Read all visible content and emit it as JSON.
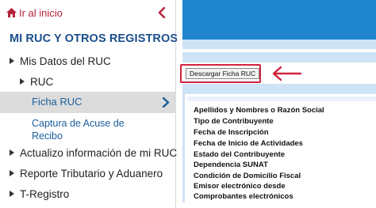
{
  "sidebar": {
    "home_label": "Ir al inicio",
    "title": "MI RUC Y OTROS REGISTROS",
    "items": [
      {
        "label": "Mis Datos del RUC"
      },
      {
        "label": "RUC"
      },
      {
        "label": "Ficha RUC"
      },
      {
        "label": "Captura de Acuse de Recibo"
      },
      {
        "label": "Actualizo información de mi RUC"
      },
      {
        "label": "Reporte Tributario y Aduanero"
      },
      {
        "label": "T-Registro"
      }
    ]
  },
  "main": {
    "download_button_label": "Descargar Ficha RUC",
    "fields": [
      "Apellidos y Nombres o Razón Social",
      "Tipo de Contribuyente",
      "Fecha de Inscripción",
      "Fecha de Inicio de Actividades",
      "Estado del Contribuyente",
      "Dependencia SUNAT",
      "Condición de Domicilio Fiscal",
      "Emisor electrónico desde",
      "Comprobantes electrónicos"
    ]
  },
  "colors": {
    "brand_red": "#b5233a",
    "title_blue": "#1a4f8c",
    "link_blue": "#1a5f9c",
    "header_blue": "#1f85cf",
    "light_blue": "#cfe3f6",
    "active_gray": "#dcdcdc",
    "annotation_red": "#d0233e"
  },
  "icons": {
    "home": "home-icon",
    "collapse": "chevron-left-icon",
    "active": "chevron-right-icon",
    "annotation": "arrow-left-icon"
  }
}
